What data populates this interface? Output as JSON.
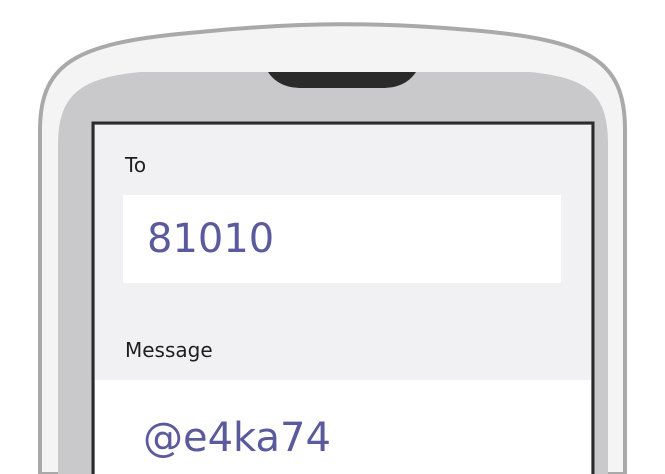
{
  "compose": {
    "to_label": "To",
    "to_value": "81010",
    "message_label": "Message",
    "message_value": "@e4ka74"
  },
  "colors": {
    "phone_outline": "#a9a9a9",
    "phone_bezel": "#c9c9cc",
    "screen_background": "#f1f1f4",
    "field_background": "#ffffff",
    "value_text": "#5a5a9c",
    "label_text": "#1f1f1f",
    "speaker": "#2a2a2a"
  }
}
